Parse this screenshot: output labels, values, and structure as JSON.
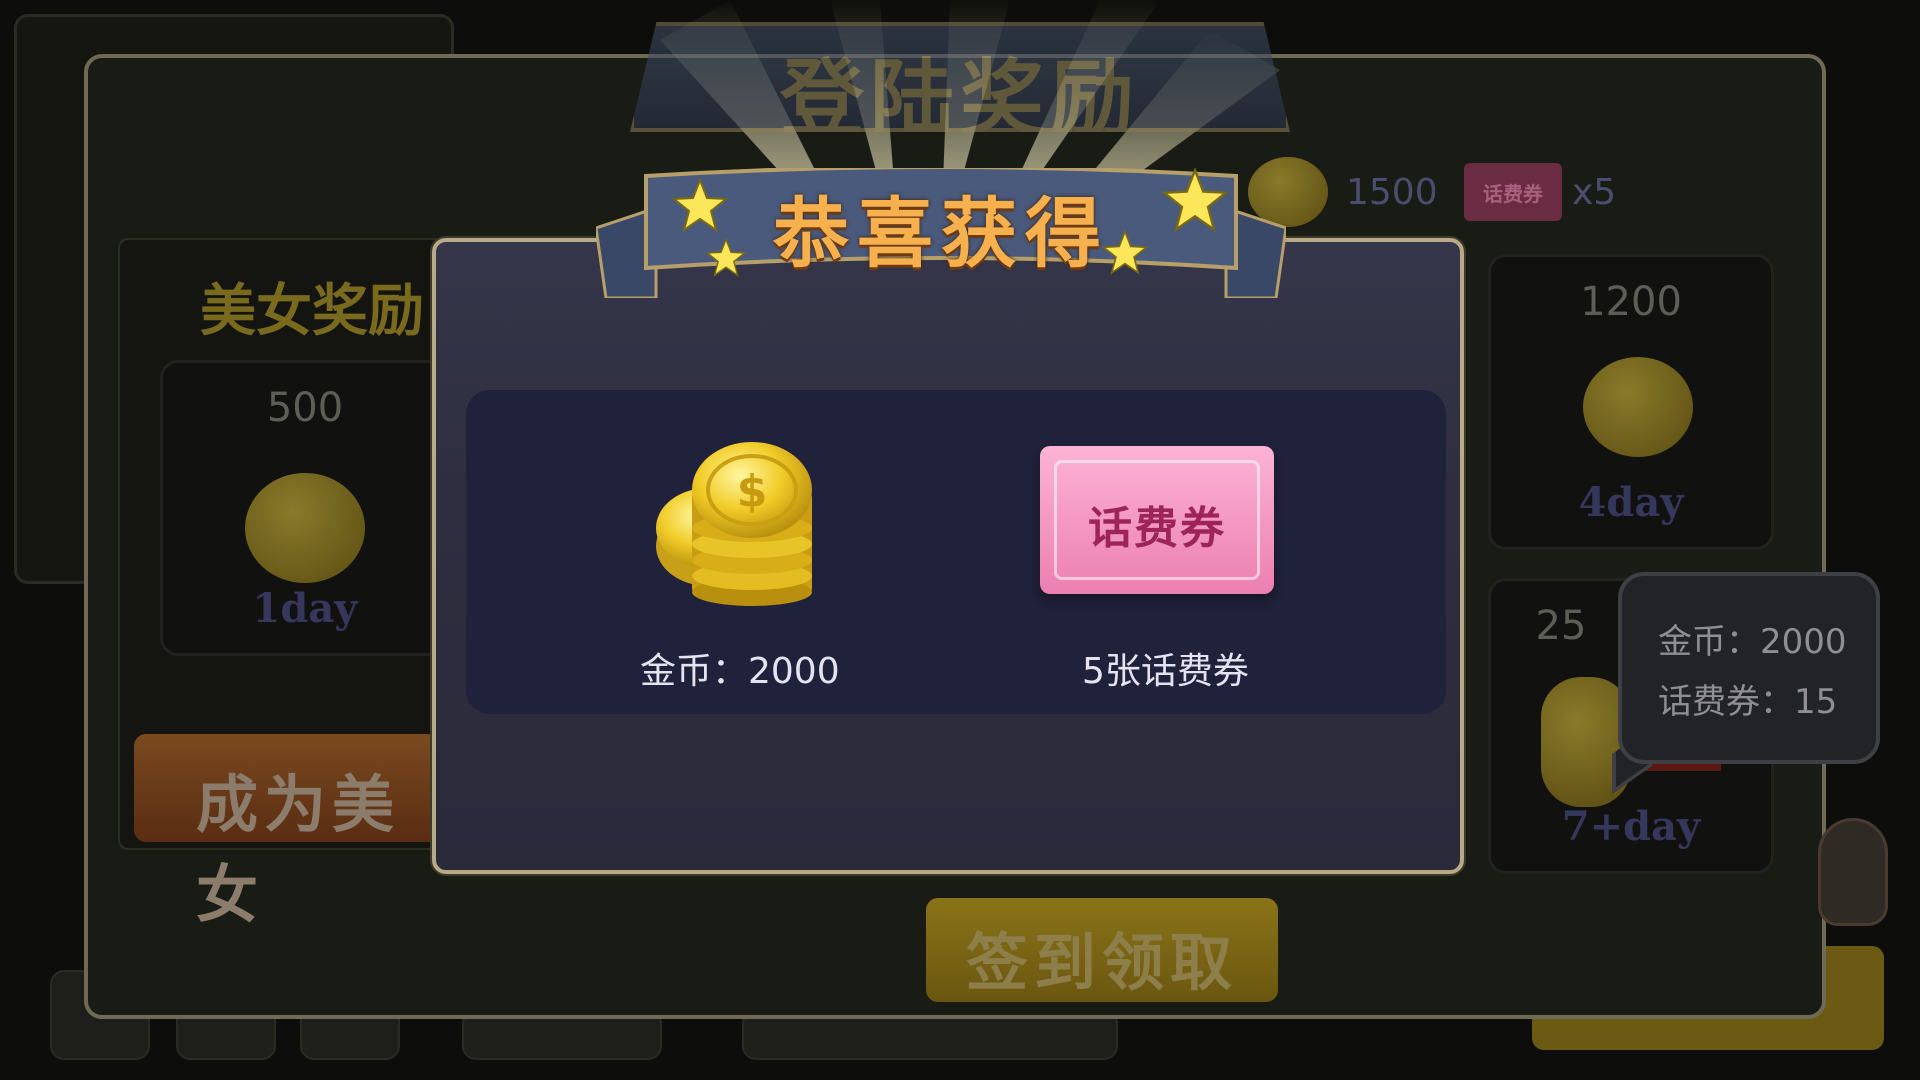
{
  "background": {
    "window_title": "登陆奖励",
    "left_card": {
      "title": "美女奖励",
      "day1": {
        "amount": "500",
        "day_label": "1day"
      },
      "become_button": "成为美女"
    },
    "top_rewards": {
      "coins": "1500",
      "ticket_icon_label": "话费券",
      "ticket_count": "x5"
    },
    "day4": {
      "amount": "1200",
      "day_label": "4day"
    },
    "day7": {
      "amount_partial": "25",
      "day_label": "7+day"
    },
    "sign_button": "签到领取"
  },
  "modal": {
    "banner_title": "恭喜获得",
    "rewards": [
      {
        "icon": "gold-coins-icon",
        "label": "金币：2000"
      },
      {
        "icon": "phone-ticket-icon",
        "ticket_text": "话费券",
        "label": "5张话费券"
      }
    ]
  },
  "tooltip": {
    "line1": "金币：2000",
    "line2": "话费券：15"
  }
}
